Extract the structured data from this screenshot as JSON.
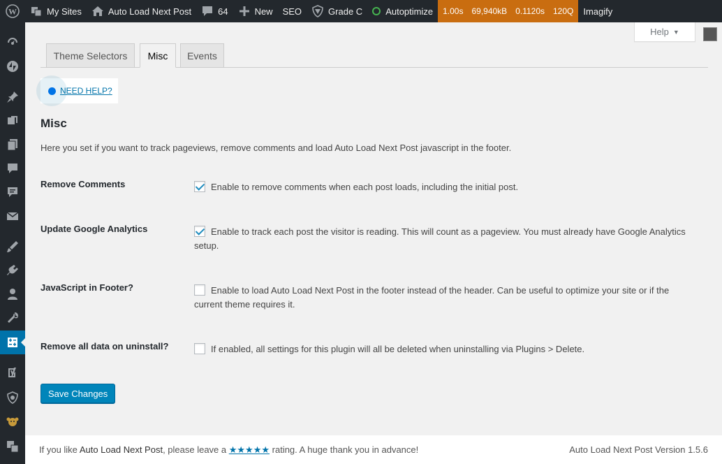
{
  "adminbar": {
    "my_sites": "My Sites",
    "site_name": "Auto Load Next Post",
    "comments_count": "64",
    "new_label": "New",
    "seo_label": "SEO",
    "grade_label": "Grade C",
    "autoptimize_label": "Autoptimize",
    "perf": [
      "1.00s",
      "69,940kB",
      "0.1120s",
      "120Q"
    ],
    "imagify_label": "Imagify"
  },
  "help": {
    "label": "Help"
  },
  "tabs": [
    {
      "label": "Theme Selectors",
      "active": false
    },
    {
      "label": "Misc",
      "active": true
    },
    {
      "label": "Events",
      "active": false
    }
  ],
  "need_help": "NEED HELP?",
  "section": {
    "title": "Misc",
    "description": "Here you set if you want to track pageviews, remove comments and load Auto Load Next Post javascript in the footer."
  },
  "settings": [
    {
      "label": "Remove Comments",
      "text": "Enable to remove comments when each post loads, including the initial post.",
      "checked": true
    },
    {
      "label": "Update Google Analytics",
      "text": "Enable to track each post the visitor is reading. This will count as a pageview. You must already have Google Analytics setup.",
      "checked": true
    },
    {
      "label": "JavaScript in Footer?",
      "text": "Enable to load Auto Load Next Post in the footer instead of the header. Can be useful to optimize your site or if the current theme requires it.",
      "checked": false
    },
    {
      "label": "Remove all data on uninstall?",
      "text": "If enabled, all settings for this plugin will all be deleted when uninstalling via Plugins > Delete.",
      "checked": false
    }
  ],
  "save_button": "Save Changes",
  "footer": {
    "left_prefix": "If you like ",
    "left_plugin": "Auto Load Next Post",
    "left_mid": ", please leave a ",
    "stars": "★★★★★",
    "left_suffix": " rating. A huge thank you in advance!",
    "version": "Auto Load Next Post Version 1.5.6"
  },
  "colors": {
    "admin_bar": "#23282d",
    "perf_bg": "#c96d10",
    "accent": "#0073aa",
    "primary_button": "#0085ba"
  }
}
